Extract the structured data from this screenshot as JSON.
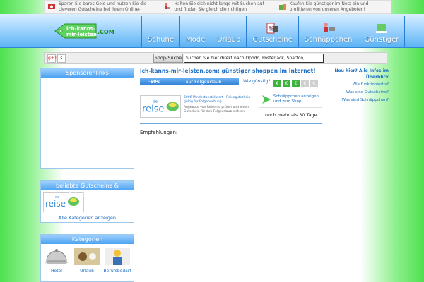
{
  "topstrip": [
    {
      "icon": "money-coupon-icon",
      "text": "Sparen Sie bares Geld und nutzen Sie die cleveren Gutscheine bei Ihrem Online-Shopping"
    },
    {
      "icon": "shopper-cart-icon",
      "text": "Halten Sie sich nicht lange mit Suchen auf und finden Sie gleich die richtigen Schnäppchen!"
    },
    {
      "icon": "shopping-bags-icon",
      "text": "Kaufen Sie günstiger im Netz ein und profitieren von unseren Angeboten!"
    }
  ],
  "logo": {
    "line1": "ich-kanns-",
    "line2": "mir-leisten",
    "tld": ".COM"
  },
  "nav": [
    {
      "label": "Schuhe",
      "icon": ""
    },
    {
      "label": "Mode",
      "icon": ""
    },
    {
      "label": "Urlaub",
      "icon": ""
    },
    {
      "label": "Gutscheine",
      "icon": "coupon-icon"
    },
    {
      "label": "Schnäppchen",
      "icon": "shopping-cart-icon"
    },
    {
      "label": "Günstiger",
      "icon": "piggy-bank-icon"
    }
  ],
  "toolbar": {
    "gplus": "g+1",
    "share": "s",
    "shop_search_label": "Shop-Suche",
    "search_value": "Suchen Sie hier direkt nach Opodo, Posterjack, Spartoo, ..."
  },
  "sponsor": {
    "title": "Sponsorenlinks"
  },
  "popular": {
    "title": "beliebte Gutscheine & Schnäppchen",
    "all_link": "Alle Kategorien anzeigen",
    "logo_text": "reise",
    "logo_prefix": "de"
  },
  "main": {
    "title": "ich-kanns-mir-leisten.com: günstiger shoppen im Internet!",
    "deal_amount": "-60€",
    "deal_label": "auf Folgeurlaub",
    "wie_guenstig": "Wie günstig?",
    "rating": [
      "€",
      "€",
      "€",
      "€",
      "€"
    ],
    "rating_level": 3,
    "deal_title": "600€ Mindestbestellwert - Reisegutschein gültig für Folgebuchung",
    "deal_desc": "Angebote von Reise.de prüfen und einen Gutschein für den Folgeurlaub sichern",
    "deal_link": "Schnäppchen anzeigen und zum Shop!",
    "days_text": "noch mehr als 30 Tage",
    "recommend": "Empfehlungen:"
  },
  "right": {
    "head": "Neu hier? Alle Infos im Überblick",
    "links": [
      "Wie funktioniert's?",
      "Was sind Gutscheine?",
      "Was sind Schnäppchen?"
    ]
  },
  "categories": {
    "title": "Kategorien",
    "items": [
      {
        "label": "Hotel",
        "icon": "hotel-bell-icon"
      },
      {
        "label": "Urlaub",
        "icon": "beach-icon"
      },
      {
        "label": "Berufsbedarf",
        "icon": "worker-icon"
      }
    ]
  },
  "colors": {
    "accent": "#1e6fc4",
    "header_blue": "#4aa2f0",
    "green_side": "#4fe04f",
    "rating_on": "#3db33d",
    "rating_off": "#cfcfcf"
  }
}
